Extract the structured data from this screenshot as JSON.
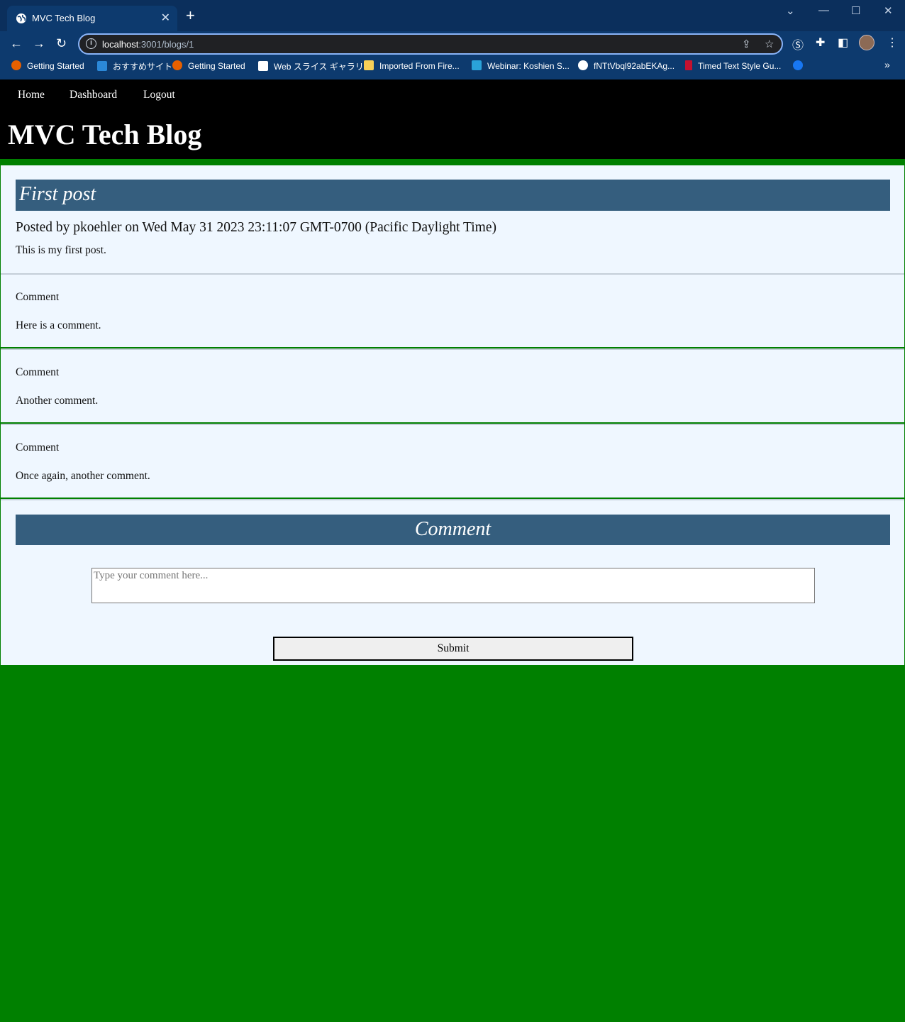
{
  "browser": {
    "tab_title": "MVC Tech Blog",
    "url_host": "localhost",
    "url_path": ":3001/blogs/1",
    "bookmarks": [
      {
        "label": "Getting Started",
        "color": "#e66000"
      },
      {
        "label": "おすすめサイト",
        "color": "#2b88d8"
      },
      {
        "label": "Getting Started",
        "color": "#e66000"
      },
      {
        "label": "Web スライス ギャラリー",
        "color": "#ffffff"
      },
      {
        "label": "Imported From Fire...",
        "color": "#f6cf57"
      },
      {
        "label": "Webinar: Koshien S...",
        "color": "#2aa3d9"
      },
      {
        "label": "fNTtVbql92abEKAg...",
        "color": "#ffffff"
      },
      {
        "label": "Timed Text Style Gu...",
        "color": "#c4112f"
      },
      {
        "label": "",
        "color": "#1877f2"
      }
    ],
    "overflow": "»"
  },
  "nav": {
    "home": "Home",
    "dashboard": "Dashboard",
    "logout": "Logout"
  },
  "site": {
    "title": "MVC Tech Blog"
  },
  "post": {
    "title": "First post",
    "meta": "Posted by pkoehler on Wed May 31 2023 23:11:07 GMT-0700 (Pacific Daylight Time)",
    "body": "This is my first post."
  },
  "comments": [
    {
      "label": "Comment",
      "text": "Here is a comment."
    },
    {
      "label": "Comment",
      "text": "Another comment."
    },
    {
      "label": "Comment",
      "text": "Once again, another comment."
    }
  ],
  "form": {
    "title": "Comment",
    "placeholder": "Type your comment here...",
    "submit_label": "Submit"
  },
  "colors": {
    "page_background": "#008000",
    "header_background": "#000000",
    "panel_background": "#eff7ff",
    "title_bar": "#355e7e"
  }
}
